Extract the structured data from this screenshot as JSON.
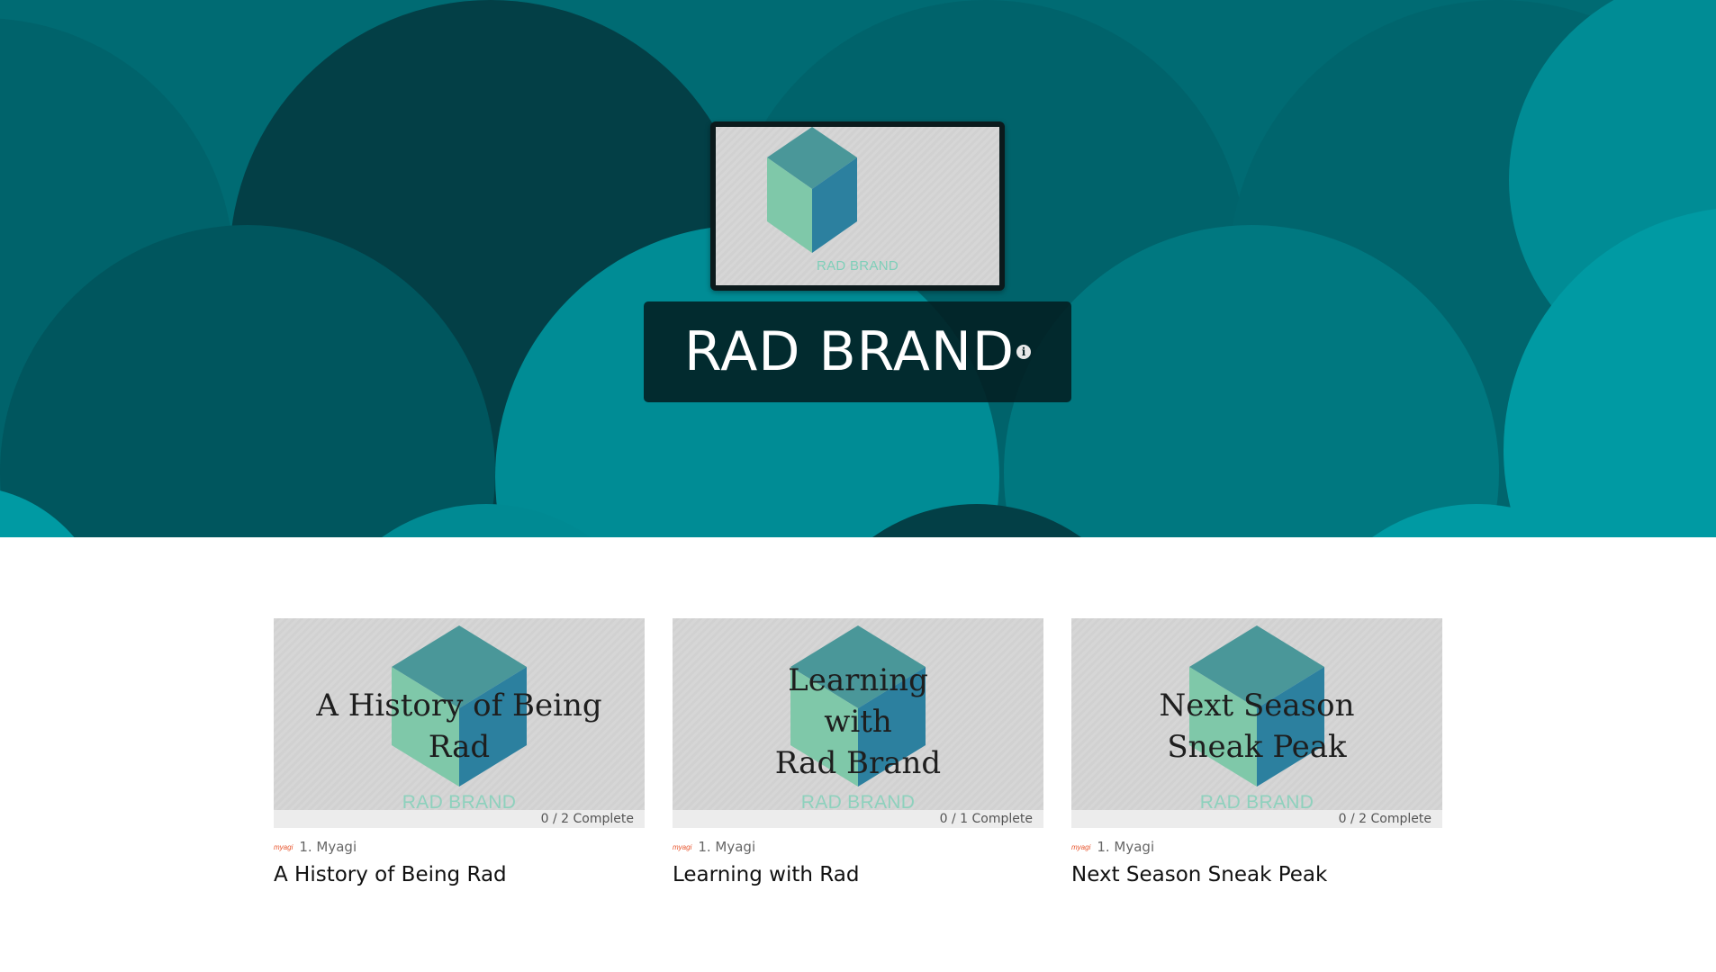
{
  "hero": {
    "logo_text": "RAD BRAND",
    "title": "RAD BRAND",
    "info_glyph": "i",
    "colors": {
      "background": "#006b73",
      "circle_dark": "#033f46",
      "circle_mid": "#00636b",
      "circle_teal": "#008c95",
      "circle_bright": "#009aa3"
    }
  },
  "cube_colors": {
    "top": "#4a9799",
    "left": "#7fc8a9",
    "right": "#2c809f"
  },
  "cards": [
    {
      "thumb_title": "A History of Being\nRad",
      "thumb_brand": "RAD BRAND",
      "progress_text": "0 / 2  Complete",
      "progress_fraction": 0,
      "meta_logo": "myagi",
      "meta_text": "1. Myagi",
      "title": "A History of Being Rad"
    },
    {
      "thumb_title": "Learning\nwith\nRad Brand",
      "thumb_brand": "RAD BRAND",
      "progress_text": "0 / 1  Complete",
      "progress_fraction": 0,
      "meta_logo": "myagi",
      "meta_text": "1. Myagi",
      "title": "Learning with Rad"
    },
    {
      "thumb_title": "Next Season\nSneak Peak",
      "thumb_brand": "RAD BRAND",
      "progress_text": "0 / 2  Complete",
      "progress_fraction": 0,
      "meta_logo": "myagi",
      "meta_text": "1. Myagi",
      "title": "Next Season Sneak Peak"
    }
  ]
}
